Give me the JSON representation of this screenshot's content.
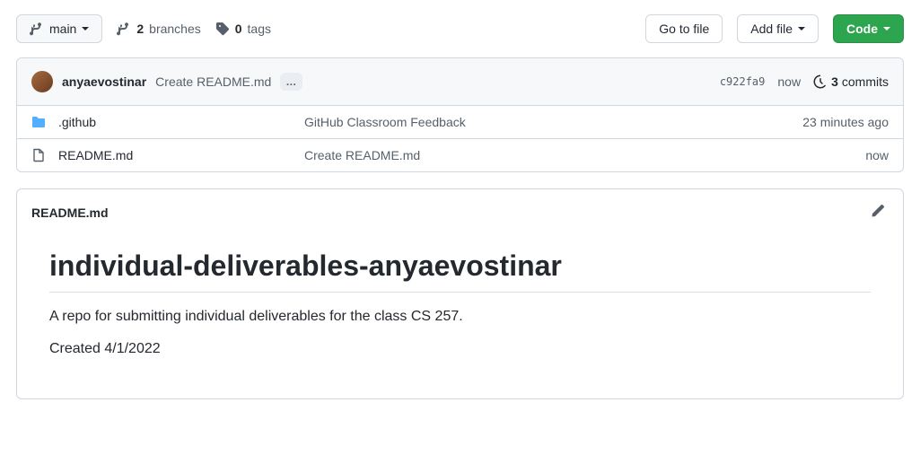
{
  "toolbar": {
    "branch_label": "main",
    "branches_count": "2",
    "branches_label": "branches",
    "tags_count": "0",
    "tags_label": "tags",
    "go_to_file": "Go to file",
    "add_file": "Add file",
    "code": "Code"
  },
  "commit": {
    "author": "anyaevostinar",
    "message": "Create README.md",
    "sha": "c922fa9",
    "time": "now",
    "commits_count": "3",
    "commits_label": "commits"
  },
  "files": [
    {
      "type": "folder",
      "name": ".github",
      "message": "GitHub Classroom Feedback",
      "time": "23 minutes ago"
    },
    {
      "type": "file",
      "name": "README.md",
      "message": "Create README.md",
      "time": "now"
    }
  ],
  "readme": {
    "filename": "README.md",
    "heading": "individual-deliverables-anyaevostinar",
    "p1": "A repo for submitting individual deliverables for the class CS 257.",
    "p2": "Created 4/1/2022"
  }
}
